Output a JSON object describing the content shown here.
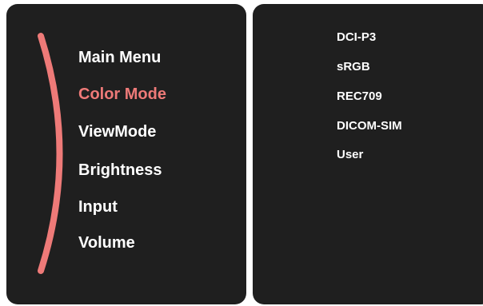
{
  "theme": {
    "panel_background": "#1f1f1f",
    "accent": "#ee7a78",
    "text": "#ffffff"
  },
  "main_menu": {
    "title": "Main Menu",
    "items": [
      {
        "label": "Color Mode",
        "selected": true
      },
      {
        "label": "ViewMode",
        "selected": false
      },
      {
        "label": "Brightness",
        "selected": false
      },
      {
        "label": "Input",
        "selected": false
      },
      {
        "label": "Volume",
        "selected": false
      }
    ]
  },
  "submenu": {
    "items": [
      {
        "label": "DCI-P3"
      },
      {
        "label": "sRGB"
      },
      {
        "label": "REC709"
      },
      {
        "label": "DICOM-SIM"
      },
      {
        "label": "User"
      }
    ]
  }
}
